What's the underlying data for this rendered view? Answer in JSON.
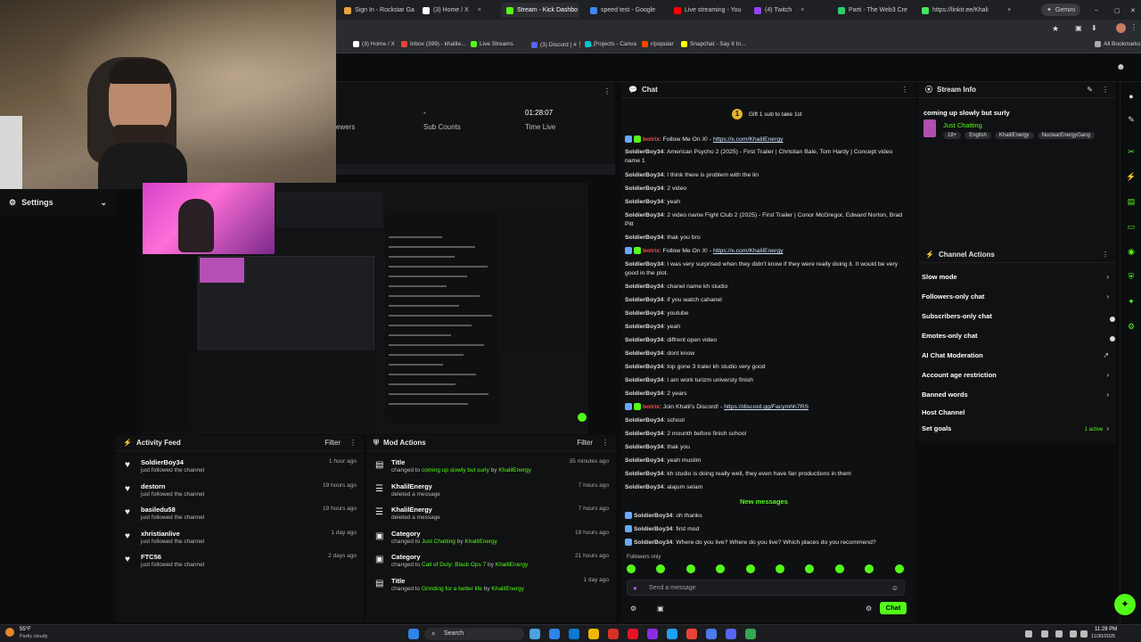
{
  "browser": {
    "tabs": [
      {
        "label": "Sign In - Rockstar Ga",
        "color": "#e8a33d"
      },
      {
        "label": "(3) Home / X",
        "color": "#ffffff"
      },
      {
        "label": "Stream - Kick Dashbo",
        "color": "#53fc18"
      },
      {
        "label": "speed test - Google",
        "color": "#4285f4"
      },
      {
        "label": "Live streaming - You",
        "color": "#ff0000"
      },
      {
        "label": "(4) Twitch",
        "color": "#9146ff"
      },
      {
        "label": "Parti - The Web3 Cre",
        "color": "#2ecc71"
      },
      {
        "label": "https://linktr.ee/Khali",
        "color": "#43e660"
      }
    ],
    "gemini": "Gemini",
    "bookmarks": [
      "(3) Home / X",
      "Inbox (399) - khalile...",
      "Live Streams",
      "(3) Discord | #❗ | a...",
      "Projects - Canva",
      "r/popular",
      "Snapchat - Say It In...",
      "All Bookmarks"
    ]
  },
  "settings": {
    "label": "Settings"
  },
  "stats": {
    "viewers_label": "ewers",
    "sub_counts_value": "-",
    "sub_counts_label": "Sub Counts",
    "time_live_value": "01:28:07",
    "time_live_label": "Time Live"
  },
  "activity_feed": {
    "title": "Activity Feed",
    "filter": "Filter",
    "items": [
      {
        "name": "SoldierBoy34",
        "sub": "just followed the channel",
        "time": "1 hour ago"
      },
      {
        "name": "destorn",
        "sub": "just followed the channel",
        "time": "19 hours ago"
      },
      {
        "name": "basiledu58",
        "sub": "just followed the channel",
        "time": "19 hours ago"
      },
      {
        "name": "xhristianlive",
        "sub": "just followed the channel",
        "time": "1 day ago"
      },
      {
        "name": "FTC56",
        "sub": "just followed the channel",
        "time": "2 days ago"
      }
    ]
  },
  "mod_actions": {
    "title": "Mod Actions",
    "filter": "Filter",
    "items": [
      {
        "name": "Title",
        "pre": "changed to",
        "hl": "coming up slowly but surly",
        "by": "by",
        "user": "KhalilEnergy",
        "time": "35 minutes ago"
      },
      {
        "name": "KhalilEnergy",
        "pre": "deleted a message",
        "hl": "",
        "by": "",
        "user": "",
        "time": "7 hours ago"
      },
      {
        "name": "KhalilEnergy",
        "pre": "deleted a message",
        "hl": "",
        "by": "",
        "user": "",
        "time": "7 hours ago"
      },
      {
        "name": "Category",
        "pre": "changed to",
        "hl": "Just Chatting",
        "by": "by",
        "user": "KhalilEnergy",
        "time": "19 hours ago"
      },
      {
        "name": "Category",
        "pre": "changed to",
        "hl": "Call of Duty: Black Ops 7",
        "by": "by",
        "user": "KhalilEnergy",
        "time": "21 hours ago"
      },
      {
        "name": "Title",
        "pre": "changed to",
        "hl": "Grinding for a better life",
        "by": "by",
        "user": "KhalilEnergy",
        "time": "1 day ago"
      }
    ]
  },
  "chat": {
    "title": "Chat",
    "gift_count": "1",
    "gift_text": "Gift 1 sub to take 1st",
    "lines": [
      {
        "user": "botrix",
        "bot": true,
        "text": ": Follow Me On X! - ",
        "link": "https://x.com/KhalilEnergy"
      },
      {
        "user": "SoldierBoy34",
        "text": ": American Psycho 2 (2025) - First Trailer | Christian Bale, Tom Hardy | Concept video name 1"
      },
      {
        "user": "SoldierBoy34",
        "text": ": I think there is problem with the lin"
      },
      {
        "user": "SoldierBoy34",
        "text": ": 2 video"
      },
      {
        "user": "SoldierBoy34",
        "text": ": yeah"
      },
      {
        "user": "SoldierBoy34",
        "text": ": 2 video name Fight Club 2 (2025) - First Trailer | Conor McGregor, Edward Norton, Brad Pitt"
      },
      {
        "user": "SoldierBoy34",
        "text": ": thak you bro"
      },
      {
        "user": "botrix",
        "bot": true,
        "text": ": Follow Me On X! - ",
        "link": "https://x.com/KhalilEnergy"
      },
      {
        "user": "SoldierBoy34",
        "text": ": I was very surprised when they didn't know if they were really doing it. It would be very good in the plot."
      },
      {
        "user": "SoldierBoy34",
        "text": ": chanel name kh studio"
      },
      {
        "user": "SoldierBoy34",
        "text": ": if you watch cahanel"
      },
      {
        "user": "SoldierBoy34",
        "text": ": youtube"
      },
      {
        "user": "SoldierBoy34",
        "text": ": yeah"
      },
      {
        "user": "SoldierBoy34",
        "text": ": diffrent open video"
      },
      {
        "user": "SoldierBoy34",
        "text": ": dont know"
      },
      {
        "user": "SoldierBoy34",
        "text": ": top gone 3 traler kh studio very good"
      },
      {
        "user": "SoldierBoy34",
        "text": ": I am work turizm universty finish"
      },
      {
        "user": "SoldierBoy34",
        "text": ": 2 years"
      },
      {
        "user": "botrix",
        "bot": true,
        "text": ": Join Khalil's Discord! - ",
        "link": "https://discord.gg/Facymhh7RS"
      },
      {
        "user": "SoldierBoy34",
        "text": ": school"
      },
      {
        "user": "SoldierBoy34",
        "text": ": 2 mounth before finish school"
      },
      {
        "user": "SoldierBoy34",
        "text": ": thak you"
      },
      {
        "user": "SoldierBoy34",
        "text": ": yeah muslim"
      },
      {
        "user": "SoldierBoy34",
        "text": ": kh studio is doing really well, they even have fan productions in them"
      },
      {
        "user": "SoldierBoy34",
        "text": ": alajum selam"
      }
    ],
    "new_messages": "New messages",
    "new_lines": [
      {
        "user": "SoldierBoy34",
        "text": ": oh thanks"
      },
      {
        "user": "SoldierBoy34",
        "text": ": first mod"
      },
      {
        "user": "SoldierBoy34",
        "text": ": Where do you live? Where do you live? Which places do you recommend?"
      }
    ],
    "followers_only": "Followers only",
    "placeholder": "Send a message",
    "send": "Chat"
  },
  "stream_info": {
    "title": "Stream Info",
    "stream_title": "coming up slowly but surly",
    "category": "Just Chatting",
    "tags": [
      "18+",
      "English",
      "KhalilEnergy",
      "NuclearEnergyGang"
    ]
  },
  "channel_actions": {
    "title": "Channel Actions",
    "items": [
      {
        "label": "Slow mode",
        "kind": "arrow"
      },
      {
        "label": "Followers-only chat",
        "kind": "arrow"
      },
      {
        "label": "Subscribers-only chat",
        "kind": "toggle"
      },
      {
        "label": "Emotes-only chat",
        "kind": "toggle"
      },
      {
        "label": "AI Chat Moderation",
        "kind": "ext"
      },
      {
        "label": "Account age restriction",
        "kind": "arrow"
      },
      {
        "label": "Banned words",
        "kind": "arrow"
      },
      {
        "label": "Host Channel",
        "kind": "none"
      },
      {
        "label": "Set goals",
        "kind": "active"
      }
    ],
    "active_text": "1 active"
  },
  "taskbar": {
    "weather_temp": "55°F",
    "weather_desc": "Partly cloudy",
    "search": "Search",
    "time": "11:28 PM",
    "date": "11/30/2025"
  }
}
